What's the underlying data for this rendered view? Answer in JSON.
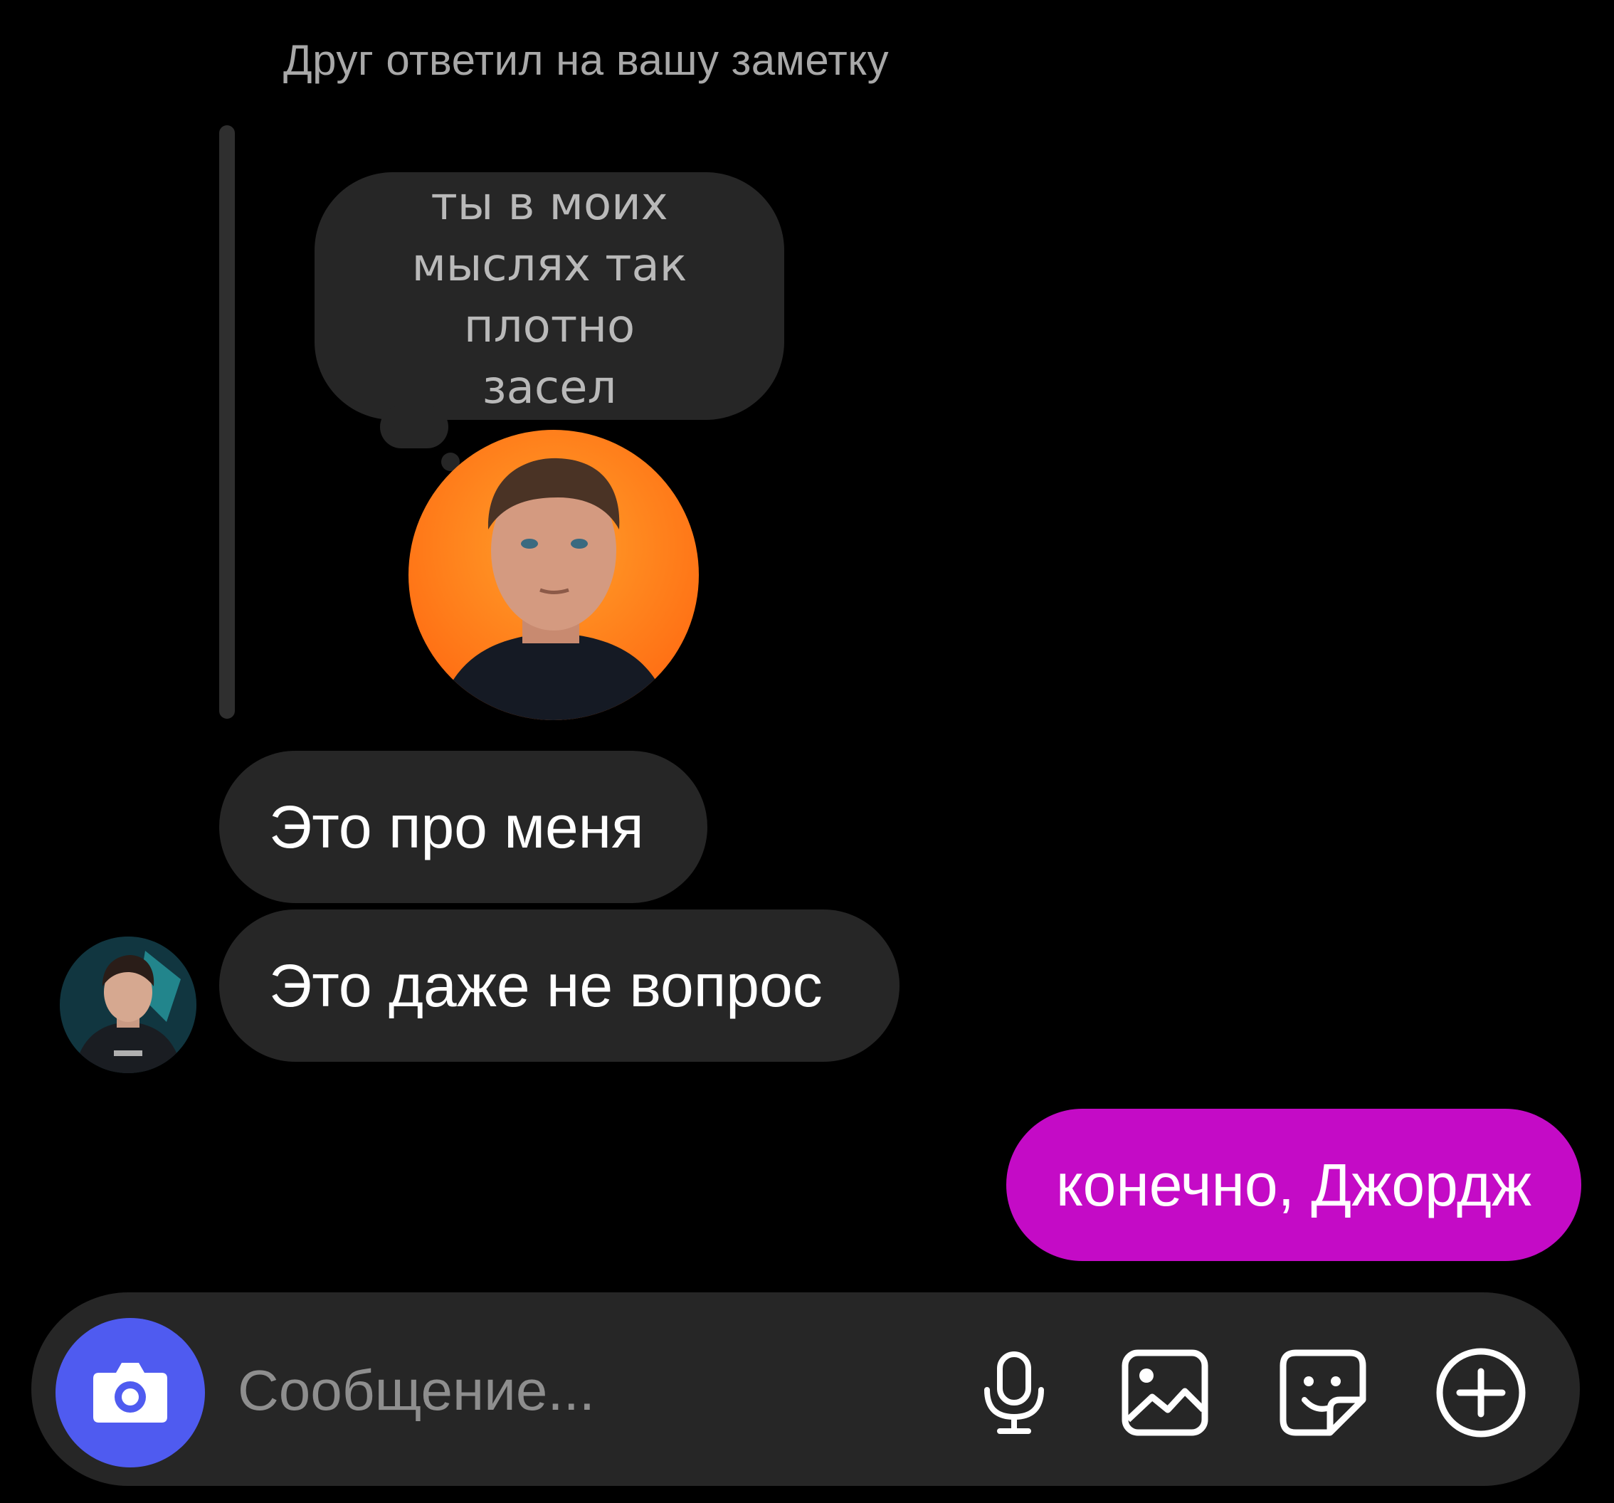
{
  "reply_context": {
    "header": "Друг ответил на вашу заметку",
    "note_text": "ты в моих мыслях так плотно засел"
  },
  "messages": [
    {
      "direction": "incoming",
      "text": "Это про меня"
    },
    {
      "direction": "incoming",
      "text": "Это даже не вопрос"
    },
    {
      "direction": "outgoing",
      "text": "конечно, Джордж"
    }
  ],
  "composer": {
    "placeholder": "Сообщение...",
    "camera_icon": "camera-icon",
    "mic_icon": "microphone-icon",
    "gallery_icon": "gallery-icon",
    "sticker_icon": "sticker-icon",
    "plus_icon": "plus-circle-icon"
  },
  "colors": {
    "background": "#000000",
    "incoming_bubble": "#262626",
    "outgoing_bubble": "#c40bc6",
    "camera_button": "#4f5bf0",
    "note_avatar_bg": "#ff8a1a"
  }
}
